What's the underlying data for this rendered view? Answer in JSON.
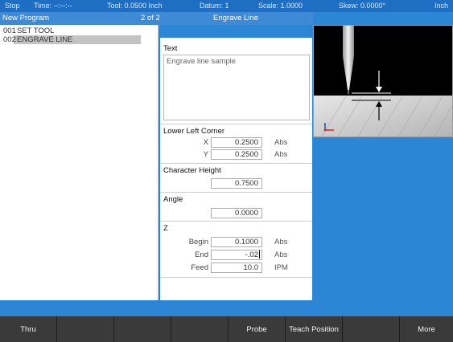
{
  "status": {
    "mode": "Stop",
    "time": "Time: --:--:--",
    "tool": "Tool: 0.0500 Inch",
    "datum": "Datum: 1",
    "scale": "Scale: 1.0000",
    "skew": "Skew: 0.0000°",
    "unit": "Inch"
  },
  "titlebar": {
    "program": "New Program",
    "position": "2 of 2",
    "step": "Engrave Line"
  },
  "program_list": [
    {
      "num": "001",
      "name": "SET TOOL"
    },
    {
      "num": "002",
      "name": "ENGRAVE LINE"
    }
  ],
  "form": {
    "text_label": "Text",
    "text_value": "Engrave line sample",
    "lower_left_label": "Lower Left Corner",
    "x_label": "X",
    "x_value": "0.2500",
    "x_unit": "Abs",
    "y_label": "Y",
    "y_value": "0.2500",
    "y_unit": "Abs",
    "char_height_label": "Character Height",
    "char_height_value": "0.7500",
    "angle_label": "Angle",
    "angle_value": "0.0000",
    "z_label": "Z",
    "begin_label": "Begin",
    "begin_value": "0.1000",
    "begin_unit": "Abs",
    "end_label": "End",
    "end_value": "-.02",
    "end_unit": "Abs",
    "feed_label": "Feed",
    "feed_value": "10.0",
    "feed_unit": "IPM"
  },
  "softkeys": [
    "Thru",
    "",
    "",
    "",
    "Probe",
    "Teach Position",
    "",
    "More"
  ],
  "colors": {
    "background": "#2b86d6",
    "status_bar": "#1e6fc4",
    "softkey": "#3a3a3a"
  }
}
